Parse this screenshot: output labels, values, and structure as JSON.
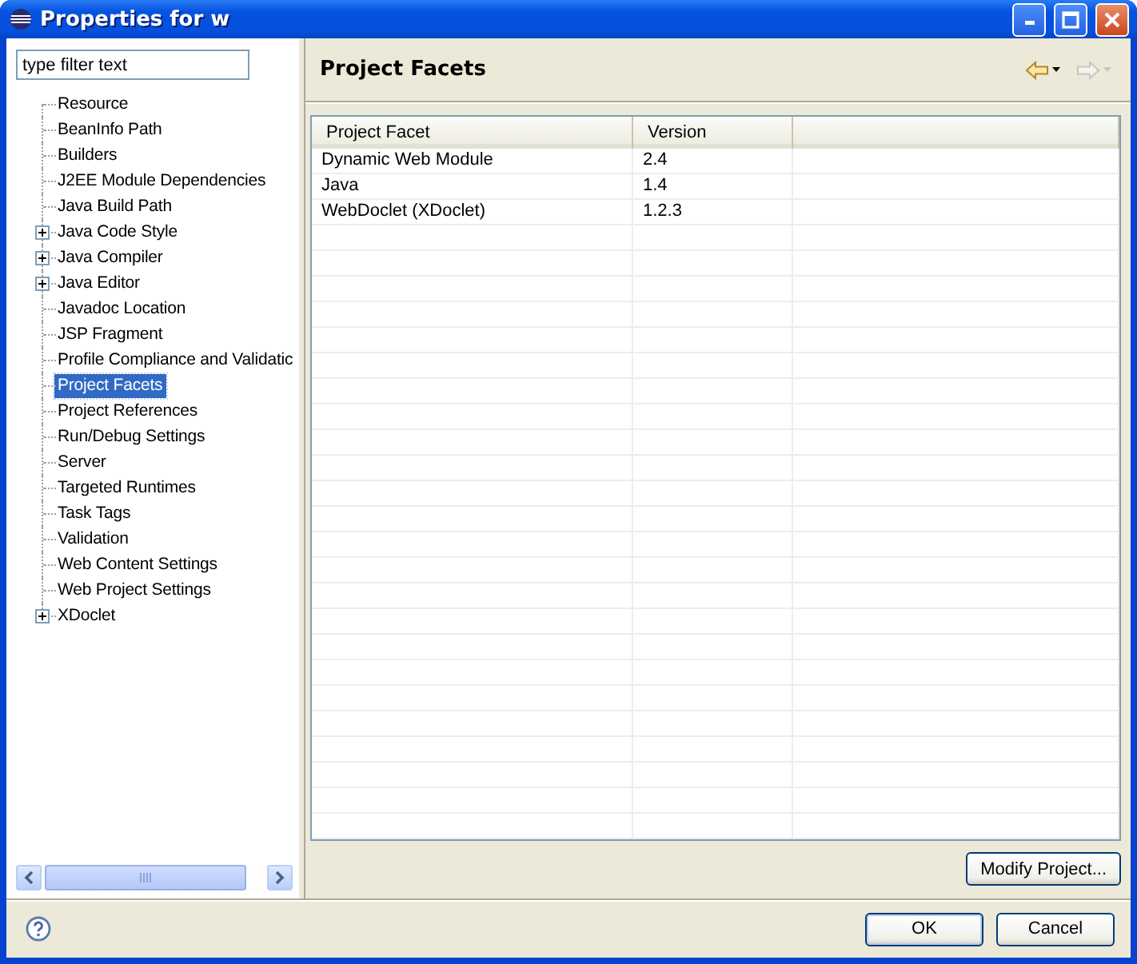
{
  "window": {
    "title": "Properties for w"
  },
  "filter": {
    "placeholder": "type filter text"
  },
  "tree": [
    {
      "label": "Resource",
      "expandable": false,
      "selected": false
    },
    {
      "label": "BeanInfo Path",
      "expandable": false,
      "selected": false
    },
    {
      "label": "Builders",
      "expandable": false,
      "selected": false
    },
    {
      "label": "J2EE Module Dependencies",
      "expandable": false,
      "selected": false
    },
    {
      "label": "Java Build Path",
      "expandable": false,
      "selected": false
    },
    {
      "label": "Java Code Style",
      "expandable": true,
      "selected": false
    },
    {
      "label": "Java Compiler",
      "expandable": true,
      "selected": false
    },
    {
      "label": "Java Editor",
      "expandable": true,
      "selected": false
    },
    {
      "label": "Javadoc Location",
      "expandable": false,
      "selected": false
    },
    {
      "label": "JSP Fragment",
      "expandable": false,
      "selected": false
    },
    {
      "label": "Profile Compliance and Validatic",
      "expandable": false,
      "selected": false
    },
    {
      "label": "Project Facets",
      "expandable": false,
      "selected": true
    },
    {
      "label": "Project References",
      "expandable": false,
      "selected": false
    },
    {
      "label": "Run/Debug Settings",
      "expandable": false,
      "selected": false
    },
    {
      "label": "Server",
      "expandable": false,
      "selected": false
    },
    {
      "label": "Targeted Runtimes",
      "expandable": false,
      "selected": false
    },
    {
      "label": "Task Tags",
      "expandable": false,
      "selected": false
    },
    {
      "label": "Validation",
      "expandable": false,
      "selected": false
    },
    {
      "label": "Web Content Settings",
      "expandable": false,
      "selected": false
    },
    {
      "label": "Web Project Settings",
      "expandable": false,
      "selected": false
    },
    {
      "label": "XDoclet",
      "expandable": true,
      "selected": false
    }
  ],
  "page": {
    "title": "Project Facets"
  },
  "table": {
    "columns": [
      "Project Facet",
      "Version"
    ],
    "rows": [
      [
        "Dynamic Web Module",
        "2.4"
      ],
      [
        "Java",
        "1.4"
      ],
      [
        "WebDoclet (XDoclet)",
        "1.2.3"
      ]
    ]
  },
  "buttons": {
    "modify": "Modify Project...",
    "ok": "OK",
    "cancel": "Cancel"
  }
}
